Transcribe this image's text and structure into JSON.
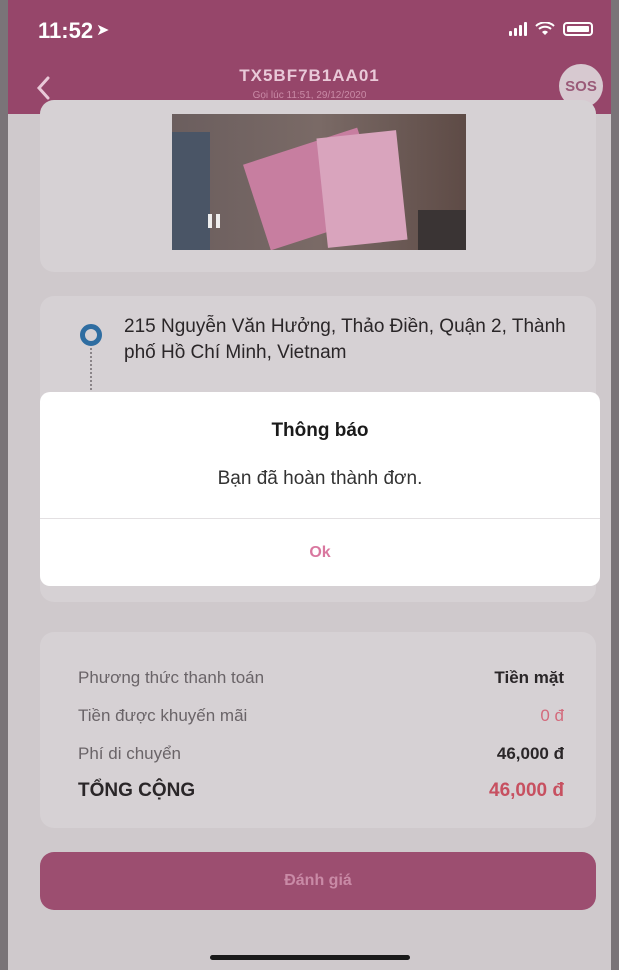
{
  "status_bar": {
    "time": "11:52"
  },
  "header": {
    "title": "TX5BF7B1AA01",
    "subtitle": "Gọi lúc 11:51, 29/12/2020",
    "sos_label": "SOS"
  },
  "address": {
    "text": "215 Nguyễn Văn Hưởng, Thảo Điền, Quận 2, Thành phố Hồ Chí Minh, Vietnam"
  },
  "payment": {
    "method_label": "Phương thức thanh toán",
    "method_value": "Tiền mặt",
    "promo_label": "Tiền được khuyến mãi",
    "promo_value": "0 đ",
    "fee_label": "Phí di chuyển",
    "fee_value": "46,000 đ",
    "total_label": "TỔNG CỘNG",
    "total_value": "46,000 đ"
  },
  "rate_button_label": "Đánh giá",
  "dialog": {
    "title": "Thông báo",
    "message": "Bạn đã hoàn thành đơn.",
    "ok_label": "Ok"
  },
  "colors": {
    "brand": "#96466a",
    "accent": "#d9779f",
    "total": "#c75060"
  }
}
